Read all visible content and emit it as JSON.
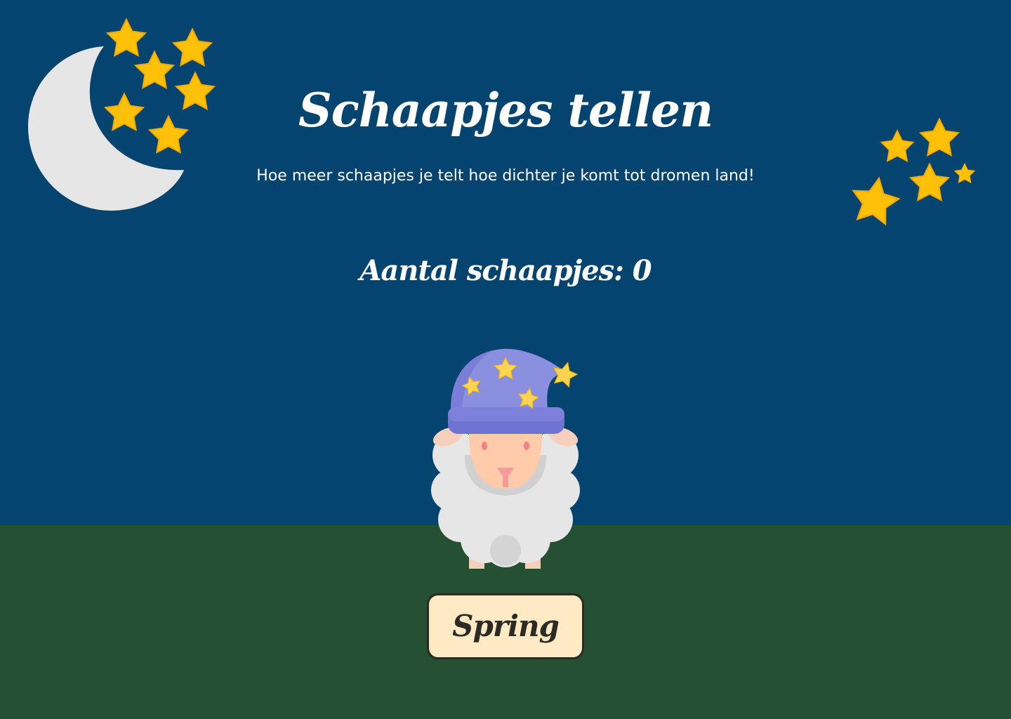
{
  "header": {
    "title": "Schaapjes tellen",
    "subtitle": "Hoe meer schaapjes je telt hoe dichter je komt tot dromen land!"
  },
  "counter": {
    "label": "Aantal schaapjes: 0",
    "count": 0
  },
  "actions": {
    "jump_label": "Spring"
  },
  "colors": {
    "sky": "#05446f",
    "grass": "#255032",
    "star": "#ffc107",
    "moon": "#e6e6e6",
    "button_bg": "#ffeac4",
    "button_border": "#2d2a26"
  },
  "icons": {
    "moon": "moon-icon",
    "star": "star-icon",
    "sheep": "sheep-with-nightcap-icon"
  }
}
